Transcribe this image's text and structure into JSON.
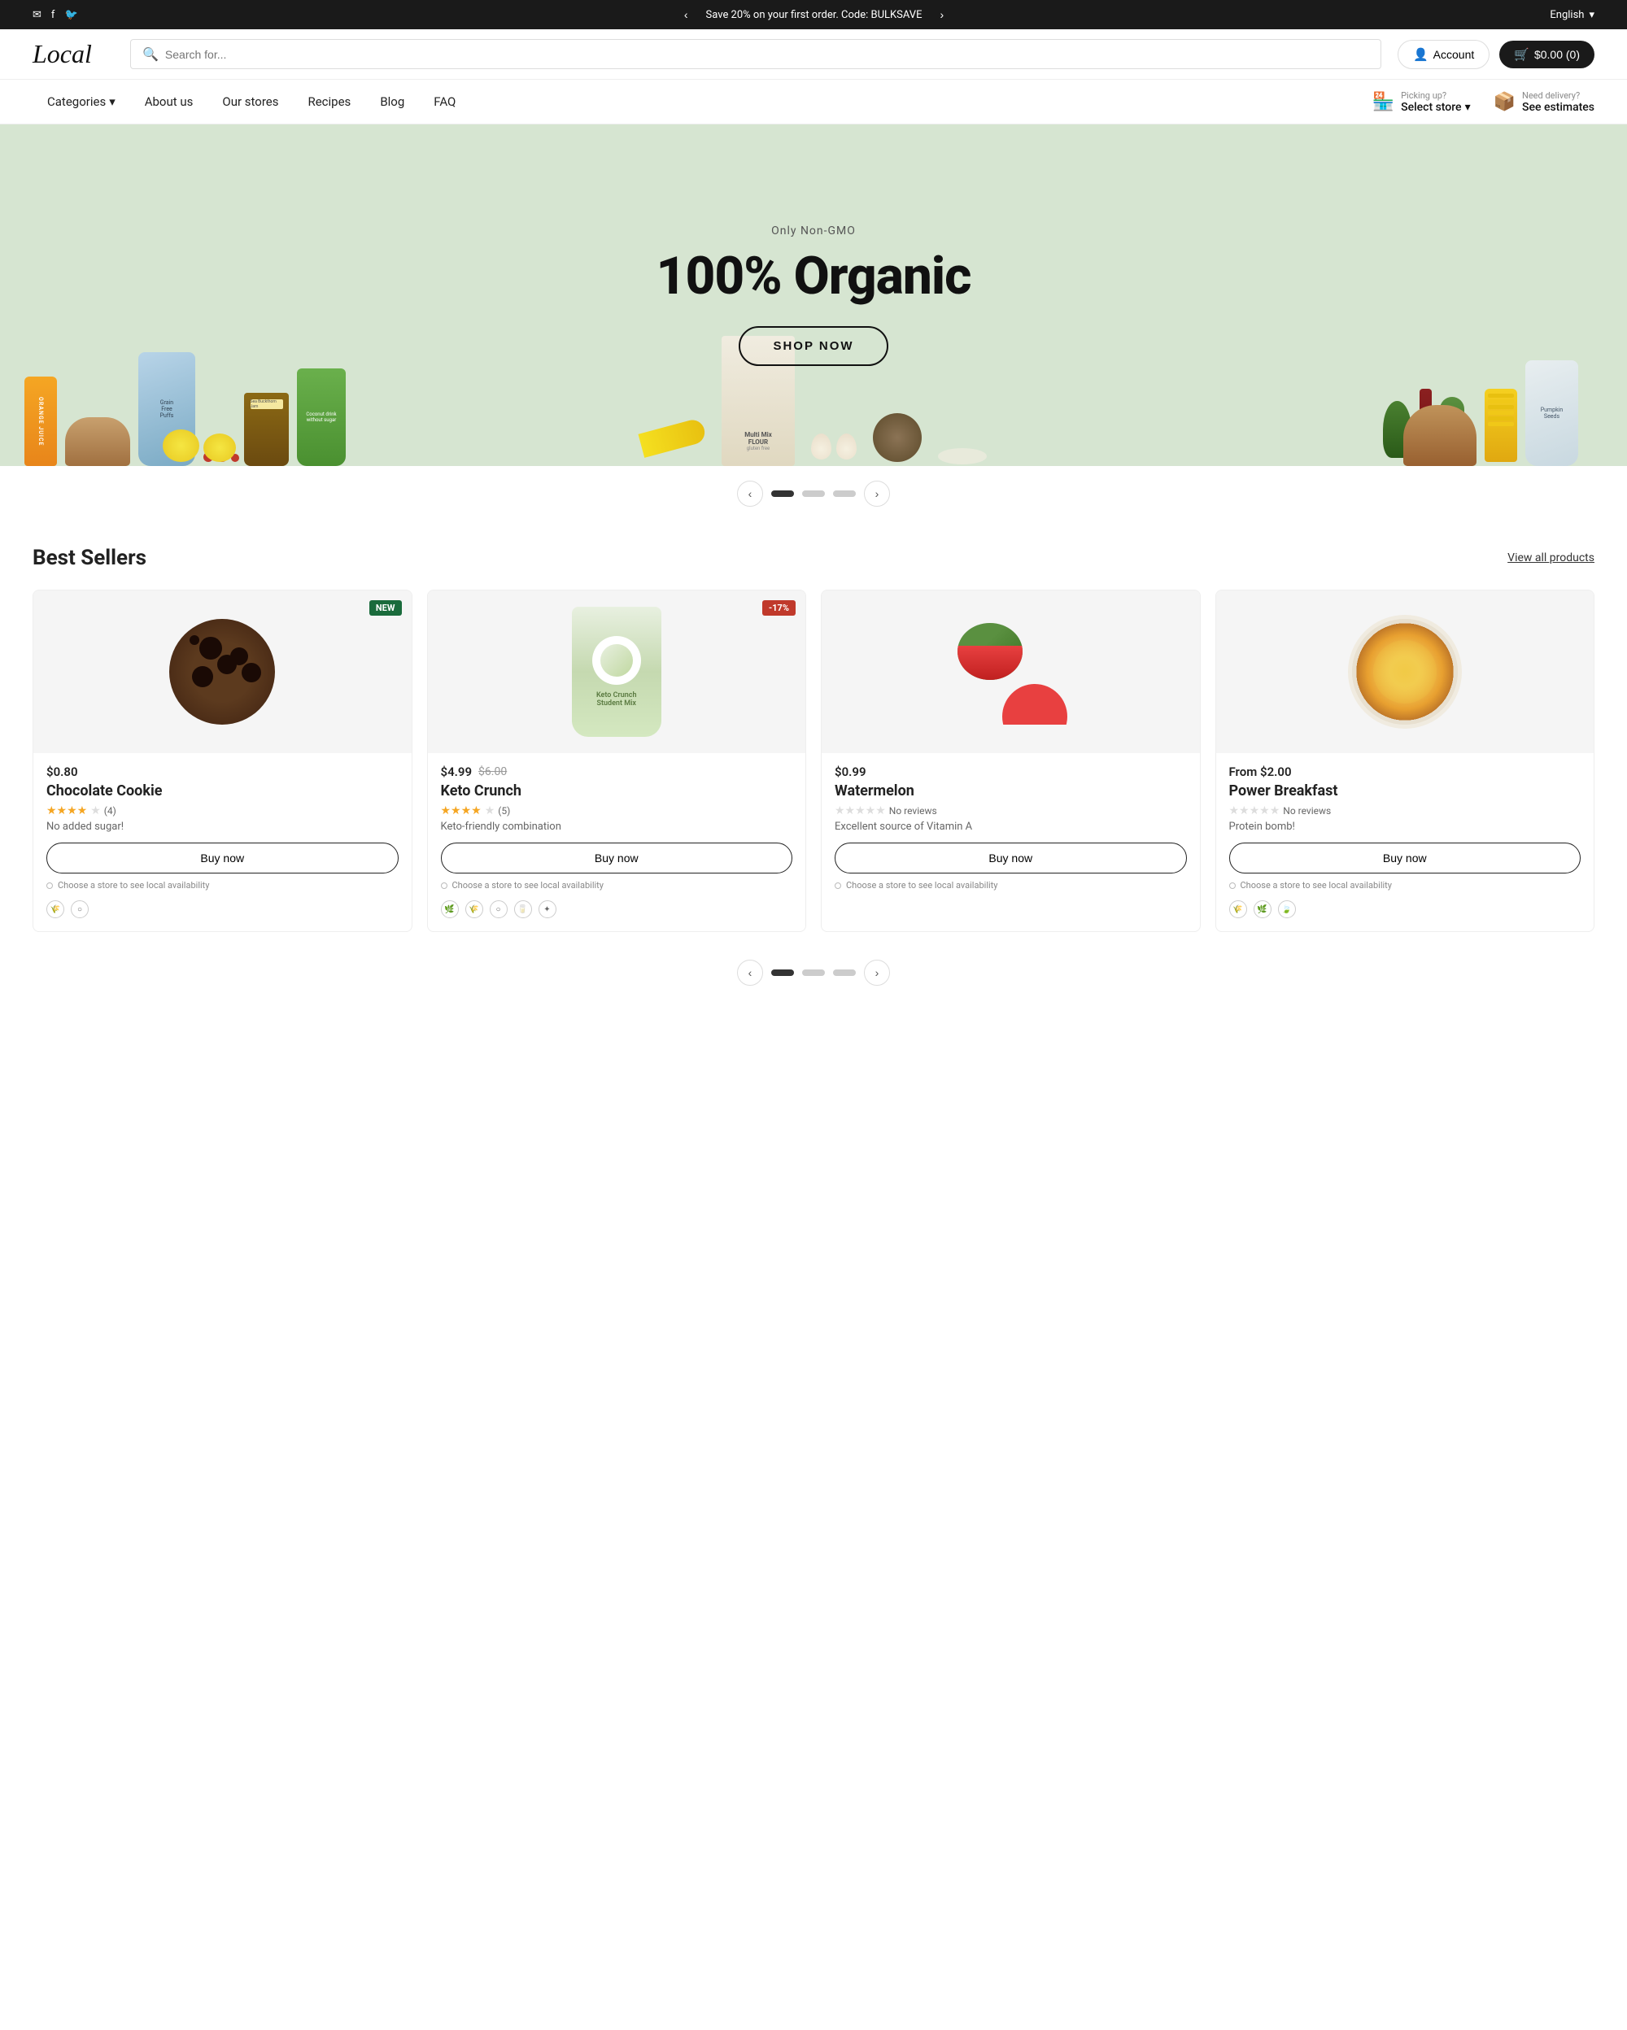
{
  "topbar": {
    "promo": "Save 20% on your first order. Code: BULKSAVE",
    "language": "English",
    "prev_btn": "‹",
    "next_btn": "›"
  },
  "header": {
    "logo": "Local",
    "search_placeholder": "Search for...",
    "account_label": "Account",
    "cart_label": "$0.00 (0)"
  },
  "nav": {
    "items": [
      {
        "label": "Categories",
        "has_dropdown": true
      },
      {
        "label": "About us"
      },
      {
        "label": "Our stores"
      },
      {
        "label": "Recipes"
      },
      {
        "label": "Blog"
      },
      {
        "label": "FAQ"
      }
    ],
    "pickup": {
      "label": "Picking up?",
      "value": "Select store",
      "has_dropdown": true
    },
    "delivery": {
      "label": "Need delivery?",
      "value": "See estimates"
    }
  },
  "hero": {
    "subtitle": "Only Non-GMO",
    "title": "100% Organic",
    "cta_label": "SHOP NOW",
    "slide_current": 1,
    "slide_total": 3
  },
  "bestsellers": {
    "section_title": "Best Sellers",
    "view_all_label": "View all products",
    "products": [
      {
        "id": "chocolate-cookie",
        "badge": "NEW",
        "badge_type": "new",
        "price": "$0.80",
        "price_prefix": "",
        "price_old": "",
        "name": "Chocolate Cookie",
        "stars_filled": 4,
        "stars_empty": 1,
        "review_count": "(4)",
        "description": "No added sugar!",
        "buy_label": "Buy now",
        "store_label": "Choose a store to see local availability",
        "icons": [
          "🌾",
          "○"
        ]
      },
      {
        "id": "keto-crunch",
        "badge": "-17%",
        "badge_type": "sale",
        "price": "$4.99",
        "price_prefix": "",
        "price_old": "$6.00",
        "name": "Keto Crunch",
        "stars_filled": 4,
        "stars_empty": 1,
        "review_count": "(5)",
        "description": "Keto-friendly combination",
        "buy_label": "Buy now",
        "store_label": "Choose a store to see local availability",
        "icons": [
          "🌿",
          "🌾",
          "○",
          "🥛",
          "✦"
        ]
      },
      {
        "id": "watermelon",
        "badge": "",
        "badge_type": "",
        "price": "$0.99",
        "price_prefix": "",
        "price_old": "",
        "name": "Watermelon",
        "stars_filled": 0,
        "stars_empty": 5,
        "review_count": "No reviews",
        "description": "Excellent source of Vitamin A",
        "buy_label": "Buy now",
        "store_label": "Choose a store to see local availability",
        "icons": []
      },
      {
        "id": "power-breakfast",
        "badge": "",
        "badge_type": "",
        "price": "From $2.00",
        "price_prefix": "From ",
        "price_old": "",
        "name": "Power Breakfast",
        "stars_filled": 0,
        "stars_empty": 5,
        "review_count": "No reviews",
        "description": "Protein bomb!",
        "buy_label": "Buy now",
        "store_label": "Choose a store to see local availability",
        "icons": [
          "🌾",
          "🌿",
          "🍃"
        ]
      }
    ]
  },
  "carousel": {
    "prev": "‹",
    "next": "›",
    "dots": [
      true,
      false,
      false
    ]
  }
}
